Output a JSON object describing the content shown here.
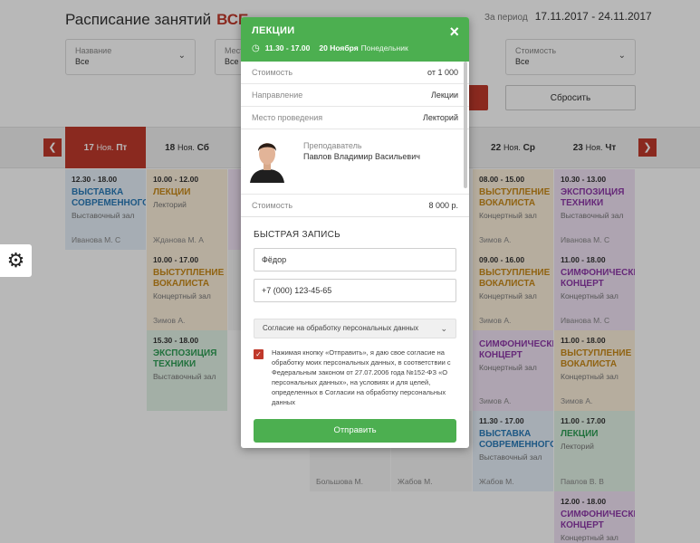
{
  "page": {
    "title": "Расписание занятий",
    "title_accent": "ВСЕ",
    "period_label": "За период",
    "period_value": "17.11.2017 - 24.11.2017"
  },
  "filters": [
    {
      "label": "Название",
      "value": "Все"
    },
    {
      "label": "Мест",
      "value": "Все"
    },
    {
      "label": "Стоимость",
      "value": "Все"
    }
  ],
  "reset_label": "Сбросить",
  "days": [
    {
      "num": "17",
      "month": "Ноя.",
      "weekday": "Пт"
    },
    {
      "num": "18",
      "month": "Ноя.",
      "weekday": "Сб"
    },
    {
      "num": "22",
      "month": "Ноя.",
      "weekday": "Ср"
    },
    {
      "num": "23",
      "month": "Ноя.",
      "weekday": "Чт"
    }
  ],
  "cards": [
    {
      "time": "12.30 - 18.00",
      "name": "ВЫСТАВКА СОВРЕМЕННОГО",
      "place": "Выставочный зал",
      "who": "Иванова М. С"
    },
    {
      "time": "10.00 - 12.00",
      "name": "ЛЕКЦИИ",
      "place": "Лекторий",
      "who": "Жданова М. А"
    },
    {
      "time": "10.00 - 17.00",
      "name": "ВЫСТУПЛЕНИЕ ВОКАЛИСТА",
      "place": "Концертный зал",
      "who": "Зимов А."
    },
    {
      "time": "15.30 - 18.00",
      "name": "ЭКСПОЗИЦИЯ ТЕХНИКИ",
      "place": "Выставочный зал",
      "who": ""
    },
    {
      "time": "08.00 - 15.00",
      "name": "ВЫСТУПЛЕНИЕ ВОКАЛИСТА",
      "place": "Концертный зал",
      "who": "Зимов А."
    },
    {
      "time": "09.00 - 16.00",
      "name": "ВЫСТУПЛЕНИЕ ВОКАЛИСТА",
      "place": "Концертный зал",
      "who": "Зимов А."
    },
    {
      "time": "",
      "name": "СИМФОНИЧЕСКИ КОНЦЕРТ",
      "place": "Концертный зал",
      "who": "Зимов А."
    },
    {
      "time": "11.30 - 17.00",
      "name": "ВЫСТАВКА СОВРЕМЕННОГО",
      "place": "Выставочный зал",
      "who": "Жабов М."
    },
    {
      "time": "10.30 - 13.00",
      "name": "ЭКСПОЗИЦИЯ ТЕХНИКИ",
      "place": "Выставочный зал",
      "who": "Иванова М. С"
    },
    {
      "time": "11.00 - 18.00",
      "name": "СИМФОНИЧЕСКИ КОНЦЕРТ",
      "place": "Концертный зал",
      "who": "Иванова М. С"
    },
    {
      "time": "11.00 - 18.00",
      "name": "ВЫСТУПЛЕНИЕ ВОКАЛИСТА",
      "place": "Концертный зал",
      "who": "Зимов А."
    },
    {
      "time": "11.00 - 17.00",
      "name": "ЛЕКЦИИ",
      "place": "Лекторий",
      "who": "Павлов В. В"
    },
    {
      "time": "12.00 - 18.00",
      "name": "СИМФОНИЧЕСКИ КОНЦЕРТ",
      "place": "Концертный зал",
      "who": ""
    }
  ],
  "bottom_names": [
    "Большова М.",
    "Жабов М."
  ],
  "modal": {
    "title": "ЛЕКЦИИ",
    "hours": "11.30  -  17.00",
    "date": "20 Ноября",
    "weekday": "Понедельник",
    "close_icon": "×",
    "rows": [
      {
        "label": "Стоимость",
        "value": "от 1 000"
      },
      {
        "label": "Направление",
        "value": "Лекции"
      },
      {
        "label": "Место проведения",
        "value": "Лекторий"
      }
    ],
    "teacher_label": "Преподаватель",
    "teacher_name": "Павлов Владимир Васильевич",
    "cost_label": "Стоимость",
    "cost_value": "8 000 р.",
    "quick_title": "БЫСТРАЯ ЗАПИСЬ",
    "name_value": "Фёдор",
    "phone_value": "+7 (000) 123-45-65",
    "consent_select": "Согласие на обработку персональных данных",
    "consent_text": "Нажимая кнопку «Отправить», я даю свое согласие на обработку моих персональных данных, в соответствии с Федеральным законом от 27.07.2006 года №152-ФЗ «О персональных данных», на условиях и для целей, определенных в Согласии на обработку персональных данных",
    "submit_label": "Отправить"
  },
  "colors": {
    "accent": "#c0392b",
    "green": "#4caf50"
  },
  "icons": {
    "settings": "gear-icon",
    "close": "close-icon",
    "clock": "clock-icon"
  }
}
